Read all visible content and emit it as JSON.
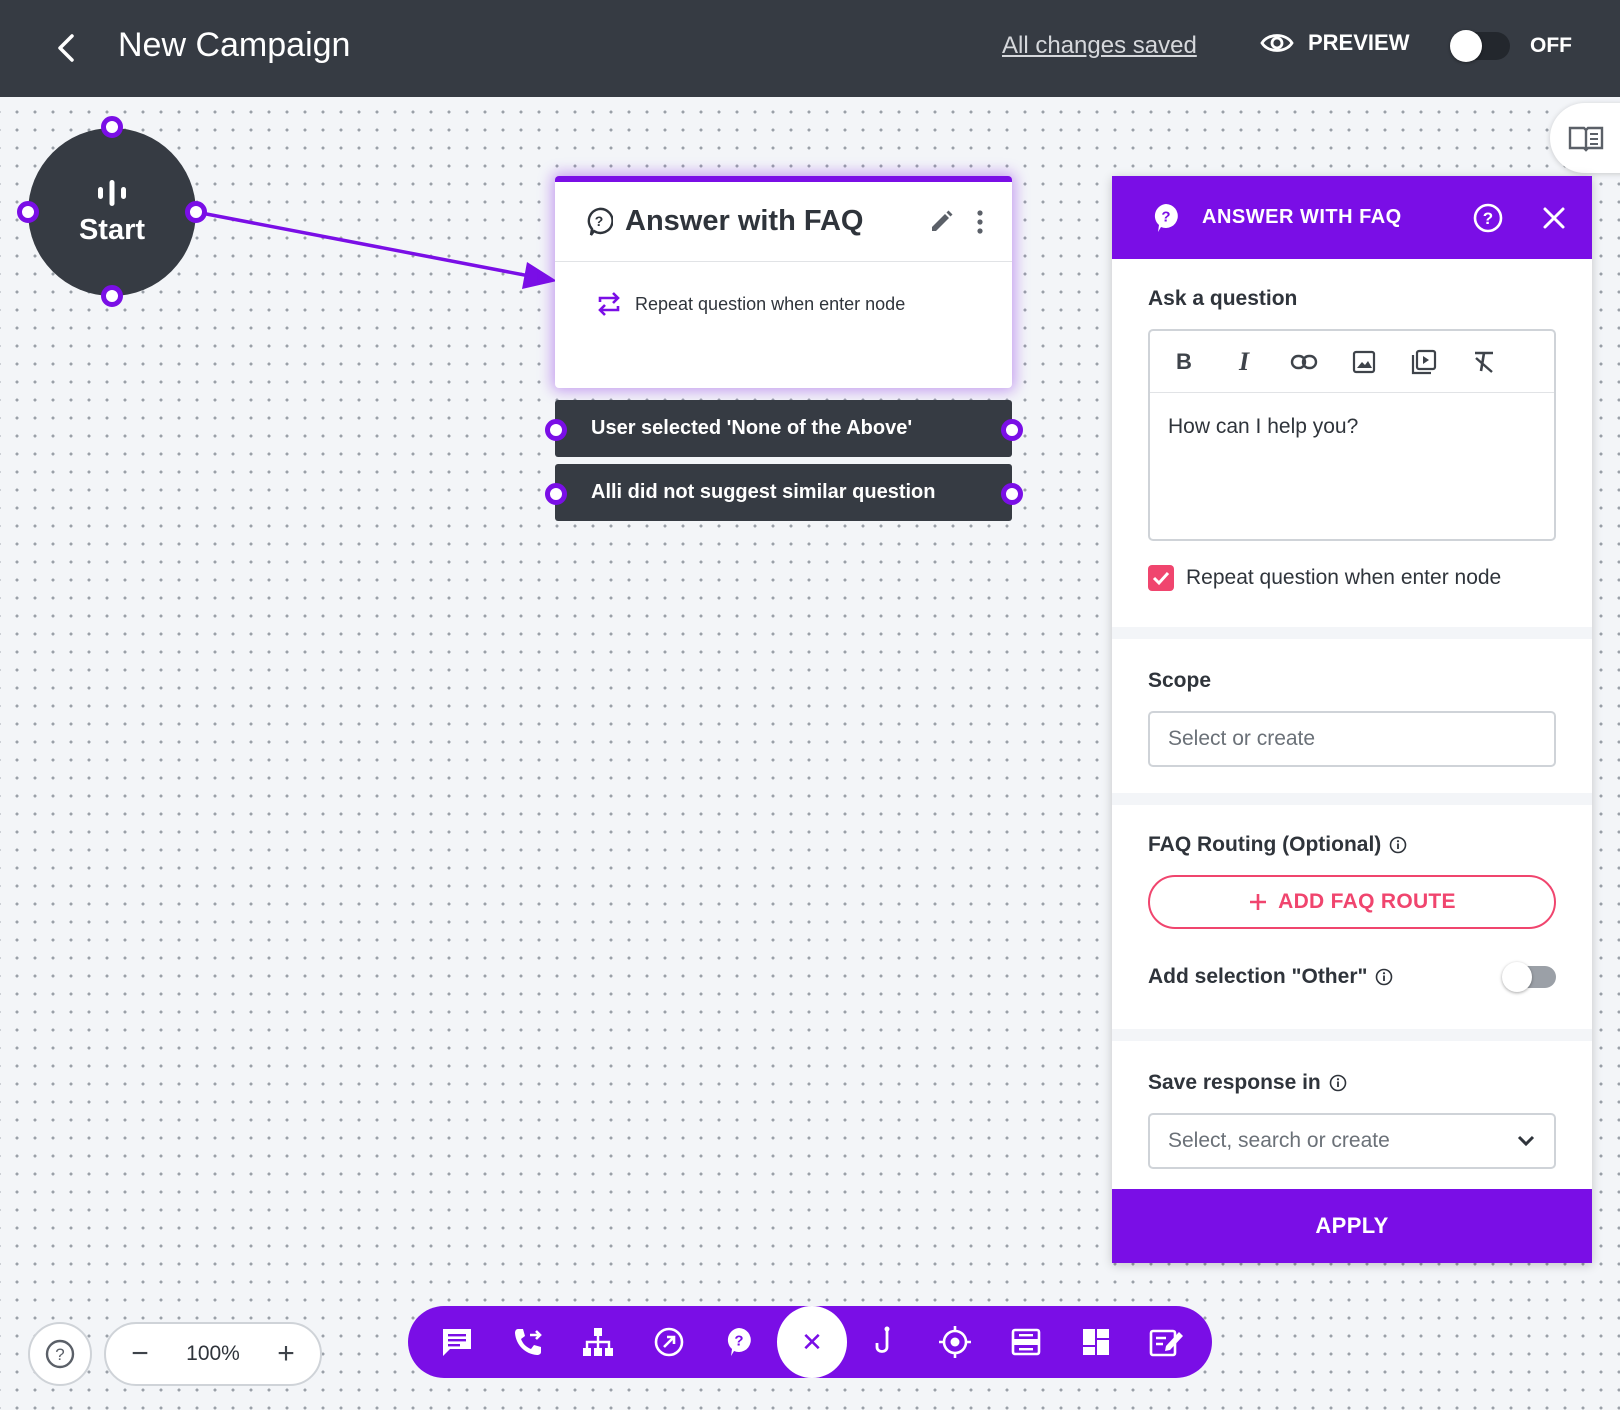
{
  "header": {
    "title": "New Campaign",
    "save_status": "All changes saved",
    "preview_label": "PREVIEW",
    "toggle_label": "OFF"
  },
  "flow": {
    "start_label": "Start",
    "faq_node": {
      "title": "Answer with FAQ",
      "option_label": "Repeat question when enter node"
    },
    "outcomes": [
      {
        "label": "User selected 'None of the Above'"
      },
      {
        "label": "Alli did not suggest similar question"
      }
    ]
  },
  "panel": {
    "title": "ANSWER WITH FAQ",
    "question_label": "Ask a question",
    "question_text": "How can I help you?",
    "repeat_label": "Repeat question when enter node",
    "repeat_checked": true,
    "scope_label": "Scope",
    "scope_placeholder": "Select or create",
    "routing_label": "FAQ Routing (Optional)",
    "add_route_label": "ADD FAQ ROUTE",
    "other_label": "Add selection \"Other\"",
    "other_enabled": false,
    "save_label": "Save response in",
    "save_placeholder": "Select, search or create",
    "apply_label": "APPLY"
  },
  "zoom": {
    "value": "100%"
  },
  "colors": {
    "accent": "#7a0ee6",
    "header_bg": "#363b43",
    "pink": "#f0456e"
  },
  "toolbar_icons": [
    "message-icon",
    "phone-forward-icon",
    "sitemap-icon",
    "link-out-icon",
    "faq-icon",
    "close-icon",
    "hook-icon",
    "target-icon",
    "form-icon",
    "dashboard-icon",
    "note-edit-icon"
  ]
}
